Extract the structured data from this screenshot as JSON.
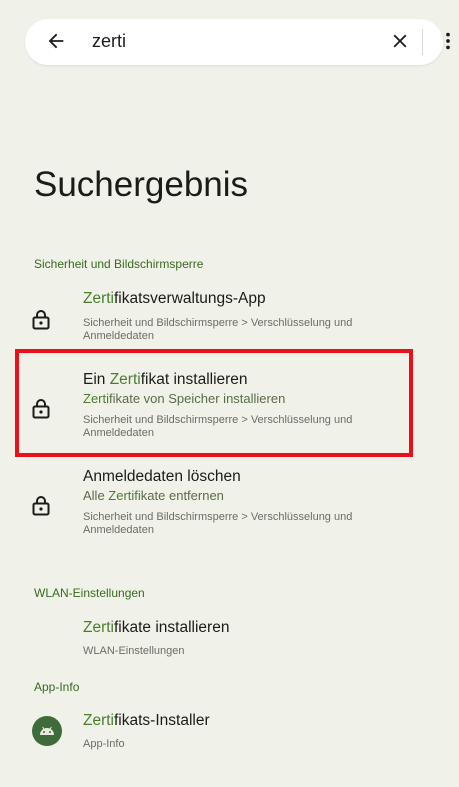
{
  "search": {
    "query": "zerti"
  },
  "page_title": "Suchergebnis",
  "sections": [
    {
      "header": "Sicherheit und Bildschirmsperre",
      "items": [
        {
          "title_hl": "Zerti",
          "title_rest": "fikatsverwaltungs-App",
          "path": "Sicherheit und Bildschirmsperre > Verschlüsselung und Anmeldedaten"
        },
        {
          "title_pre": "Ein ",
          "title_hl": "Zerti",
          "title_rest": "fikat installieren",
          "subtitle_hl": "Zerti",
          "subtitle_rest": "fikate von Speicher installieren",
          "path": "Sicherheit und Bildschirmsperre > Verschlüsselung und Anmeldedaten"
        },
        {
          "title": "Anmeldedaten löschen",
          "subtitle_pre": "Alle ",
          "subtitle_hl": "Zerti",
          "subtitle_rest": "fikate entfernen",
          "path": "Sicherheit und Bildschirmsperre > Verschlüsselung und Anmeldedaten"
        }
      ]
    },
    {
      "header": "WLAN-Einstellungen",
      "items": [
        {
          "title_hl": "Zerti",
          "title_rest": "fikate installieren",
          "path": "WLAN-Einstellungen"
        }
      ]
    },
    {
      "header": "App-Info",
      "items": [
        {
          "title_hl": "Zerti",
          "title_rest": "fikats-Installer",
          "path": "App-Info"
        }
      ]
    }
  ],
  "icons": {
    "back": "arrow-left-icon",
    "clear": "close-icon",
    "more": "more-vert-icon",
    "lock": "lock-icon",
    "app": "android-app-icon"
  },
  "colors": {
    "accent": "#386a20",
    "highlight_text": "#4b7d2c",
    "annotation_box": "#e8101a",
    "background": "#f0f1e9"
  }
}
